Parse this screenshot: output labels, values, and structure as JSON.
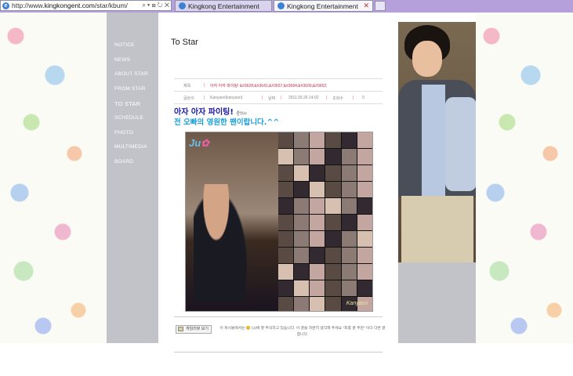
{
  "browser": {
    "url_prefix": "http://www.",
    "url_domain": "kingkongent.com",
    "url_path": "/star/kbum/",
    "addr_controls": "⌕ ▾ ⊠ ↻ ✕",
    "tabs": [
      {
        "label": "Kingkong Entertainment",
        "active": false
      },
      {
        "label": "Kingkong Entertainment",
        "active": true,
        "close": "✕"
      }
    ]
  },
  "nav": {
    "items": [
      {
        "label": "NOTICE"
      },
      {
        "label": "NEWS"
      },
      {
        "label": "ABOUT STAR"
      },
      {
        "label": "FROM STAR"
      },
      {
        "label": "TO STAR",
        "active": true
      },
      {
        "label": "SCHEDULE"
      },
      {
        "label": "PHOTO"
      },
      {
        "label": "MULTIMEDIA"
      },
      {
        "label": "BOARD"
      }
    ]
  },
  "post": {
    "page_title": "To Star",
    "subject_label": "제목",
    "subject_value": "아자 아자 파이팅! &#3628;&#3641;&#3657;&#3684;&#3609;&#3652;",
    "author_label": "글쓴이",
    "author_value": "Kanyasri(kanyasri)",
    "date_label": "날짜",
    "date_value": "2011.09.26 14:02",
    "views_label": "조회수",
    "views_value": "0",
    "separator": "|",
    "message_line1": "아자 아자 파이팅!",
    "message_line1_suffix": "สู้ๆนะ",
    "message_line2": "전 오빠의 영원한 팬이랍니다.^^",
    "collage_logo": "Ju",
    "collage_logo_flower": "✿",
    "collage_caption": "Kanyasri",
    "footer_button": "게임리뷰 보기",
    "footer_notice": "이 게시물에서는 😊 (1)에 잘 주의하고 있습니다. 이 글을 차분히 생각해 주세요 \"최종 글 추천\" 이다 다른 글 합니다."
  },
  "colors": {
    "sidebar": "#c2c3c8",
    "message_line1": "#1a1aa8",
    "message_line2": "#1ba0d8",
    "subject": "#c03050"
  }
}
